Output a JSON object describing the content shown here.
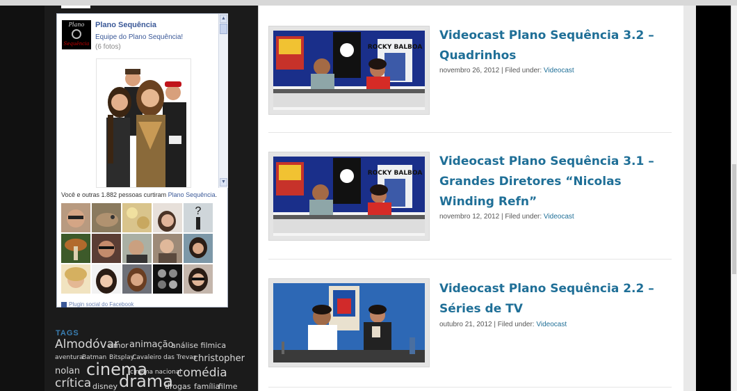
{
  "facebook": {
    "page_name": "Plano Sequência",
    "album_title": "Equipe do Plano Sequência!",
    "photo_count": "(6 fotos)",
    "logo_top": "Plano",
    "logo_bottom": "Sequência",
    "likes_prefix": "Você e outras 1.882 pessoas curtiram ",
    "likes_link": "Plano Sequência",
    "likes_suffix": ".",
    "footer": "Plugin social do Facebook"
  },
  "tags": {
    "title": "TAGS",
    "items": [
      {
        "label": "Almodóvar",
        "size": "big"
      },
      {
        "label": "amor",
        "size": "small"
      },
      {
        "label": "animação",
        "size": "mid"
      },
      {
        "label": "análise filmica",
        "size": "small"
      },
      {
        "label": "aventura",
        "size": "tiny"
      },
      {
        "label": "Batman",
        "size": "tiny"
      },
      {
        "label": "Bitsplay",
        "size": "tiny"
      },
      {
        "label": "Cavaleiro das Trevas",
        "size": "tiny"
      },
      {
        "label": "christopher nolan",
        "size": "mid"
      },
      {
        "label": "cinema",
        "size": "huge"
      },
      {
        "label": "cinema nacional",
        "size": "tiny"
      },
      {
        "label": "comédia",
        "size": "big"
      },
      {
        "label": "crítica",
        "size": "big"
      },
      {
        "label": "disney",
        "size": "small"
      },
      {
        "label": "drama",
        "size": "huge"
      },
      {
        "label": "drogas",
        "size": "small"
      },
      {
        "label": "família",
        "size": "small"
      },
      {
        "label": "filme",
        "size": "small"
      }
    ]
  },
  "posts": [
    {
      "title": "Videocast Plano Sequência 3.2 – Quadrinhos",
      "date": "novembro 26, 2012",
      "filed": " | Filed under: ",
      "category": "Videocast",
      "poster_text": "ROCKY BALBOA"
    },
    {
      "title": "Videocast Plano Sequência 3.1 – Grandes Diretores “Nicolas Winding Refn”",
      "date": "novembro 12, 2012",
      "filed": " | Filed under: ",
      "category": "Videocast",
      "poster_text": "ROCKY BALBOA"
    },
    {
      "title": "Videocast Plano Sequência 2.2 – Séries de TV",
      "date": "outubro 21, 2012",
      "filed": " | Filed under: ",
      "category": "Videocast"
    }
  ]
}
